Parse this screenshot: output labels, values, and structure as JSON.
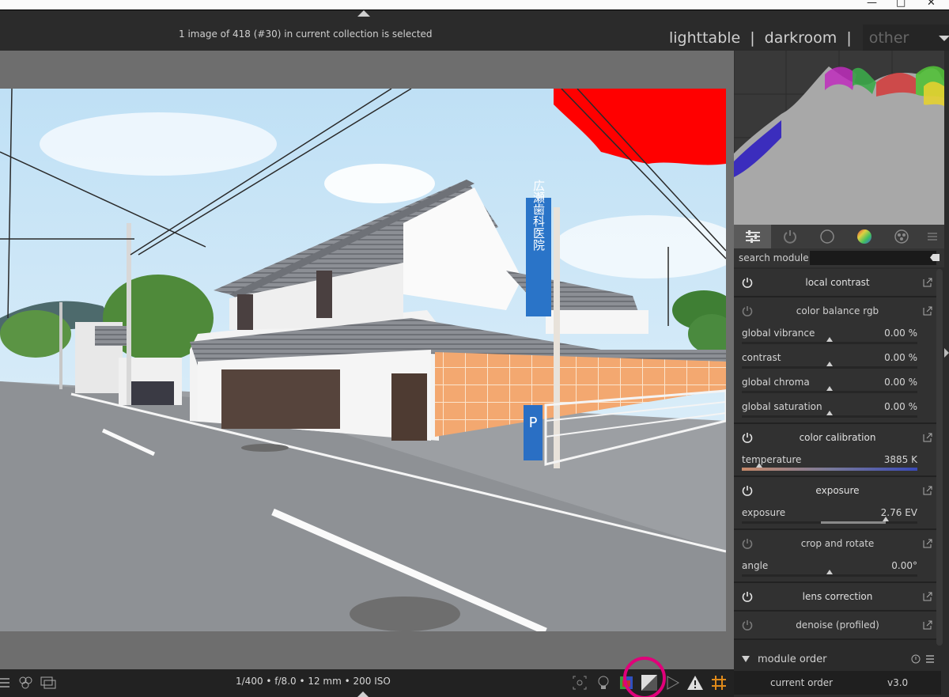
{
  "window": {
    "controls": [
      "—",
      "□",
      "✕"
    ]
  },
  "header": {
    "status": "1 image of 418 (#30) in current collection is selected",
    "views": {
      "lighttable": "lighttable",
      "darkroom": "darkroom",
      "separator": "|",
      "other": "other"
    }
  },
  "search": {
    "label": "search module",
    "value": ""
  },
  "modules": [
    {
      "id": "local-contrast",
      "title": "local contrast",
      "enabled": true,
      "params": []
    },
    {
      "id": "color-balance-rgb",
      "title": "color balance rgb",
      "enabled": false,
      "params": [
        {
          "label": "global vibrance",
          "value": "0.00 %",
          "level": 0.5
        },
        {
          "label": "contrast",
          "value": "0.00 %",
          "level": 0.5
        },
        {
          "label": "global chroma",
          "value": "0.00 %",
          "level": 0.5
        },
        {
          "label": "global saturation",
          "value": "0.00 %",
          "level": 0.5
        }
      ]
    },
    {
      "id": "color-calibration",
      "title": "color calibration",
      "enabled": true,
      "params": [
        {
          "label": "temperature",
          "value": "3885 K",
          "level": 0.1,
          "gradient": true
        }
      ]
    },
    {
      "id": "exposure",
      "title": "exposure",
      "enabled": true,
      "params": [
        {
          "label": "exposure",
          "value": "2.76 EV",
          "level": 0.82,
          "fill_from": 0.45
        }
      ]
    },
    {
      "id": "crop-and-rotate",
      "title": "crop and rotate",
      "enabled": false,
      "params": [
        {
          "label": "angle",
          "value": "0.00°",
          "level": 0.5
        }
      ]
    },
    {
      "id": "lens-correction",
      "title": "lens correction",
      "enabled": true,
      "params": []
    },
    {
      "id": "denoise-profiled",
      "title": "denoise (profiled)",
      "enabled": false,
      "params": []
    }
  ],
  "module_order": {
    "title": "module order",
    "current_label": "current order",
    "version": "v3.0"
  },
  "bottom": {
    "exif": "1/400 • f/8.0 • 12 mm • 200 ISO"
  },
  "photo": {
    "sign_text": "広瀬歯科医院",
    "parking": "P"
  },
  "colors": {
    "clip_warning": "#ff0000",
    "highlight_circle": "#e0007a",
    "panel": "#2b2b2b"
  }
}
